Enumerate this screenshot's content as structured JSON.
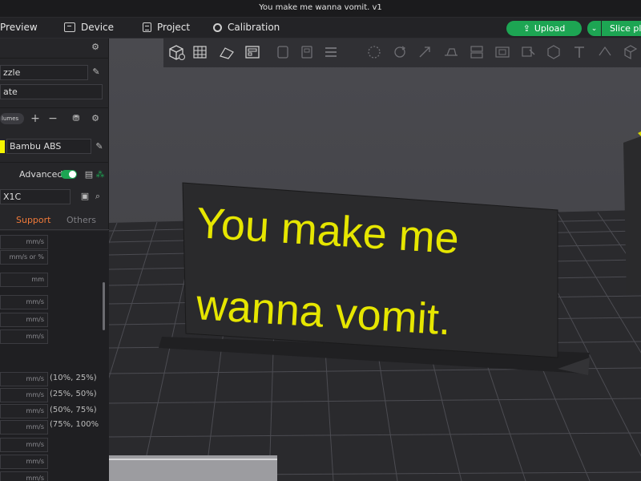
{
  "window": {
    "title": "You make me wanna vomit. v1"
  },
  "nav": {
    "preview": "Preview",
    "device": "Device",
    "project": "Project",
    "calibration": "Calibration"
  },
  "actions": {
    "upload": "Upload",
    "dropdown": "⌄",
    "slice": "Slice pla"
  },
  "left_panel": {
    "nozzle_value": "zzle",
    "plate_value": "ate",
    "volumes_chip": "lumes",
    "filament_name": "Bambu ABS",
    "filament_color": "#f5f500",
    "advanced_label": "Advanced",
    "printer_preset": "X1C",
    "tabs": {
      "support": "Support",
      "others": "Others"
    },
    "fields": [
      {
        "unit": "mm/s",
        "range": ""
      },
      {
        "unit": "mm/s or %",
        "range": ""
      },
      {
        "unit": "mm",
        "range": ""
      },
      {
        "unit": "mm/s",
        "range": ""
      },
      {
        "unit": "mm/s",
        "range": ""
      },
      {
        "unit": "mm/s",
        "range": ""
      },
      {
        "unit": "mm/s",
        "range": "(10%, 25%)"
      },
      {
        "unit": "mm/s",
        "range": "(25%, 50%)"
      },
      {
        "unit": "mm/s",
        "range": "(50%, 75%)"
      },
      {
        "unit": "mm/s",
        "range": "(75%, 100%"
      },
      {
        "unit": "mm/s",
        "range": ""
      },
      {
        "unit": "mm/s",
        "range": ""
      },
      {
        "unit": "mm/s",
        "range": ""
      }
    ]
  },
  "scene": {
    "model_text_line1": "You make me",
    "model_text_line2": "wanna vomit.",
    "text_color": "#e6e600",
    "plate_color": "#282828"
  },
  "colors": {
    "accent": "#1da553",
    "support_tab": "#f07a3a"
  }
}
